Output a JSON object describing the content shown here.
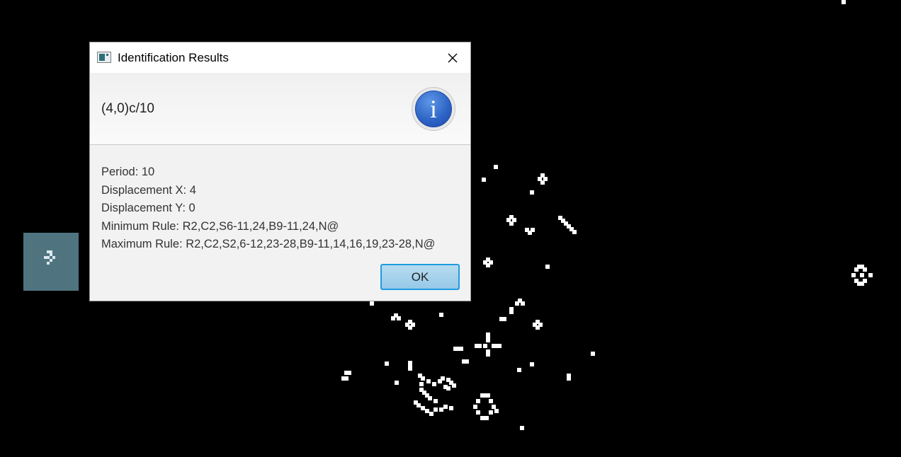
{
  "dialog": {
    "title": "Identification Results",
    "headline": "(4,0)c/10",
    "info_glyph": "i",
    "details": {
      "period": "Period: 10",
      "displacement_x": "Displacement X: 4",
      "displacement_y": "Displacement Y: 0",
      "minimum_rule": "Minimum Rule: R2,C2,S6-11,24,B9-11,24,N@",
      "maximum_rule": "Maximum Rule: R2,C2,S2,6-12,23-28,B9-11,14,16,19,23-28,N@"
    },
    "ok_label": "OK",
    "icons": [
      "app-window-icon",
      "close-icon",
      "info-icon"
    ]
  },
  "colors": {
    "background": "#000000",
    "cell": "#ffffff",
    "selection": "#4f7480",
    "accent": "#1e9be0"
  }
}
